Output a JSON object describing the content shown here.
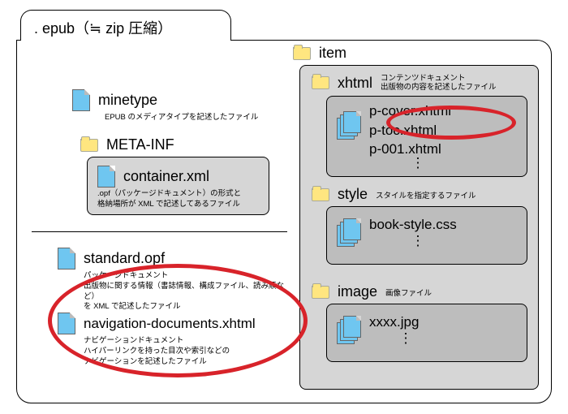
{
  "tab": ". epub（≒ zip 圧縮）",
  "minetype": {
    "label": "minetype",
    "desc": "EPUB のメディアタイプを記述したファイル"
  },
  "metaInf": {
    "folder": "META-INF",
    "file": "container.xml",
    "desc": ".opf（パッケージドキュメント）の形式と\n格納場所が XML で記述してあるファイル"
  },
  "standard": {
    "file": "standard.opf",
    "desc1": "パッケージドキュメント",
    "desc2": "出版物に関する情報（書誌情報、構成ファイル、読み順など）\nを XML で記述したファイル"
  },
  "nav": {
    "file": "navigation-documents.xhtml",
    "desc1": "ナビゲーションドキュメント",
    "desc2": "ハイパーリンクを持った目次や索引などの\nナビゲーションを記述したファイル"
  },
  "item": {
    "folder": "item",
    "xhtml": {
      "folder": "xhtml",
      "desc": "コンテンツドキュメント\n出版物の内容を記述したファイル",
      "files": [
        "p-cover.xhtml",
        "p-toc.xhtml",
        "p-001.xhtml"
      ],
      "dots": "⋮"
    },
    "style": {
      "folder": "style",
      "desc": "スタイルを指定するファイル",
      "file": "book-style.css",
      "dots": "⋮"
    },
    "image": {
      "folder": "image",
      "desc": "画像ファイル",
      "file": "xxxx.jpg",
      "dots": "⋮"
    }
  }
}
